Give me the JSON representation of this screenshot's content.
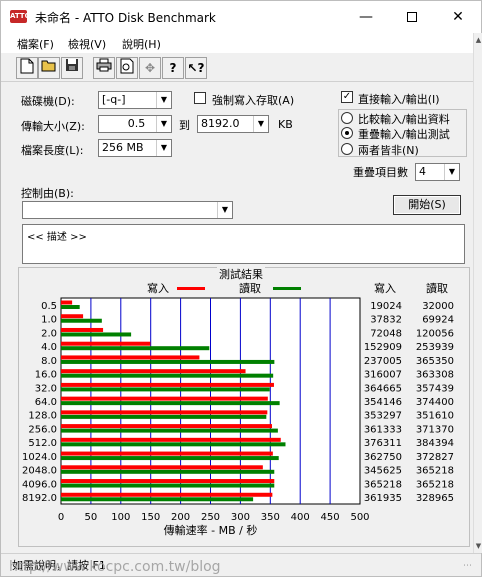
{
  "window": {
    "title": "未命名 - ATTO Disk Benchmark",
    "icon_text": "ATTO"
  },
  "menu": {
    "file": "檔案(F)",
    "view": "檢視(V)",
    "help": "說明(H)"
  },
  "toolbar": {
    "icons": [
      "new-icon",
      "open-icon",
      "save-icon",
      "print-icon",
      "print-preview-icon",
      "move-icon",
      "help-icon",
      "context-help-icon"
    ]
  },
  "form": {
    "drive_label": "磁碟機(D):",
    "drive_value": "[-q-]",
    "force_write_label": "強制寫入存取(A)",
    "force_write_checked": false,
    "direct_io_label": "直接輸入/輸出(I)",
    "direct_io_checked": true,
    "transfer_label": "傳輸大小(Z):",
    "transfer_from": "0.5",
    "to_label": "到",
    "transfer_to": "8192.0",
    "kb_label": "KB",
    "file_length_label": "檔案長度(L):",
    "file_length_value": "256 MB",
    "mode_compare": "比較輸入/輸出資料",
    "mode_overlap": "重疊輸入/輸出測試",
    "mode_neither": "兩者皆非(N)",
    "mode_selected": "overlap",
    "queue_label": "重疊項目數",
    "queue_value": "4",
    "controlled_by_label": "控制由(B):",
    "controlled_by_value": "",
    "start_label": "開始(S)",
    "description": "<< 描述 >>"
  },
  "results": {
    "title": "測試結果",
    "write_legend": "寫入",
    "read_legend": "讀取",
    "write_col": "寫入",
    "read_col": "讀取",
    "write_color": "#ff0000",
    "read_color": "#008000",
    "grid_color": "#0000cc",
    "xlabel": "傳輸速率 - MB / 秒"
  },
  "chart_data": {
    "type": "bar",
    "orientation": "horizontal",
    "categories": [
      "0.5",
      "1.0",
      "2.0",
      "4.0",
      "8.0",
      "16.0",
      "32.0",
      "64.0",
      "128.0",
      "256.0",
      "512.0",
      "1024.0",
      "2048.0",
      "4096.0",
      "8192.0"
    ],
    "series": [
      {
        "name": "寫入",
        "values": [
          19024,
          37832,
          72048,
          152909,
          237005,
          316007,
          364665,
          354146,
          353297,
          361333,
          376311,
          362750,
          345625,
          365218,
          361935
        ]
      },
      {
        "name": "讀取",
        "values": [
          32000,
          69924,
          120056,
          253939,
          365350,
          363308,
          357439,
          374400,
          351610,
          371370,
          384394,
          372827,
          365218,
          365218,
          328965
        ]
      }
    ],
    "value_unit_note": "KB/s values displayed; x axis in MB/s",
    "xticks": [
      "0",
      "50",
      "100",
      "150",
      "200",
      "250",
      "300",
      "350",
      "400",
      "450",
      "500"
    ],
    "xlim": [
      0,
      500
    ],
    "xlabel": "傳輸速率 - MB / 秒",
    "grid": true,
    "legend": "top"
  },
  "status": {
    "text": "如需說明，請按 F1"
  },
  "watermark": "http://www.kocpc.com.tw/blog"
}
